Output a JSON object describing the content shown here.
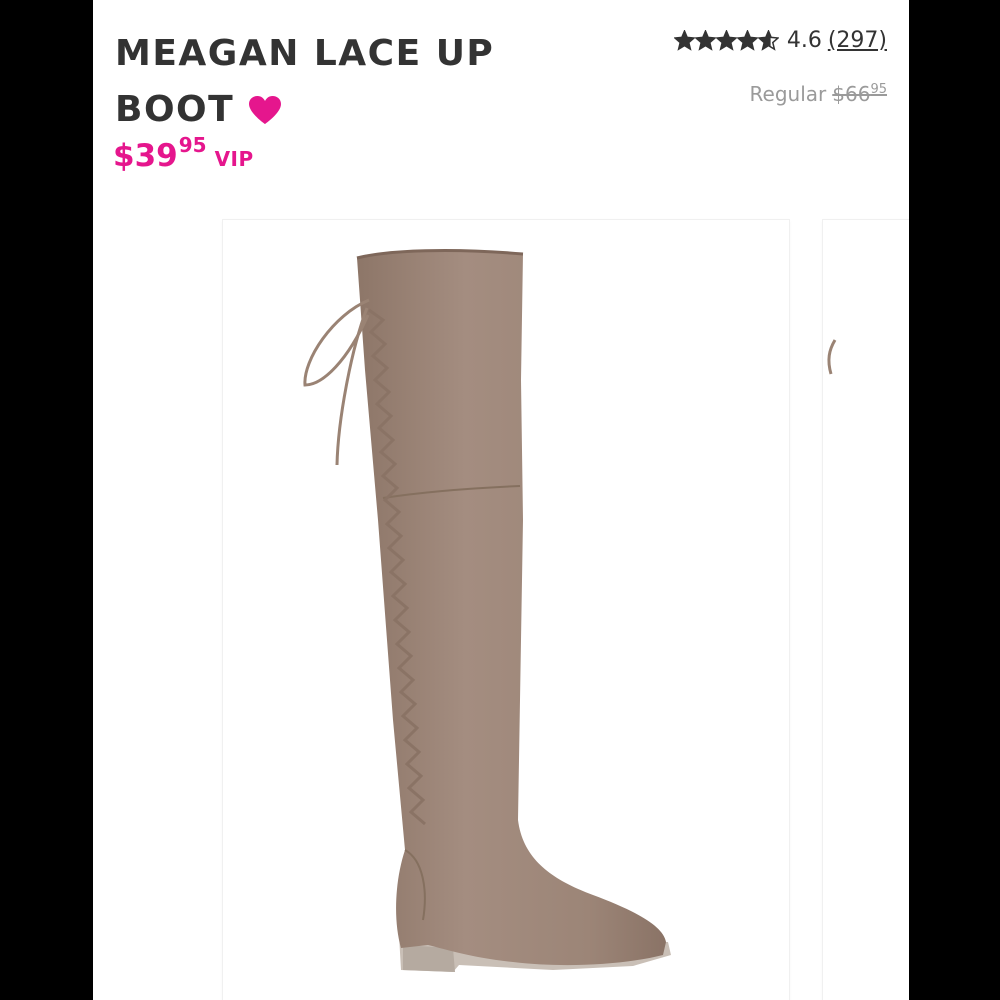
{
  "product": {
    "title": "MEAGAN LACE UP BOOT",
    "vip_price_dollars": "$39",
    "vip_price_cents": "95",
    "vip_label": "VIP",
    "regular_label": "Regular",
    "regular_price_dollars": "$66",
    "regular_price_cents": "95"
  },
  "rating": {
    "value": "4.6",
    "count": "(297)",
    "stars_filled": 4.6,
    "stars_total": 5
  },
  "icons": {
    "favorite": "heart-icon",
    "rating": "star-icon",
    "product_image": "boot-image"
  },
  "colors": {
    "accent": "#e5168d",
    "text": "#333333",
    "muted": "#9a9a9a",
    "boot": "#9c8577"
  }
}
